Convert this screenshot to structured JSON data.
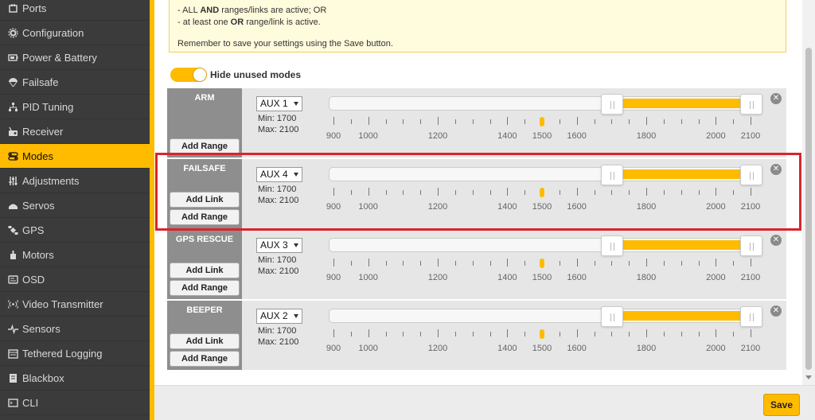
{
  "sidebar": {
    "items": [
      {
        "label": "Ports",
        "icon": "ports-icon"
      },
      {
        "label": "Configuration",
        "icon": "gear-icon"
      },
      {
        "label": "Power & Battery",
        "icon": "battery-icon"
      },
      {
        "label": "Failsafe",
        "icon": "parachute-icon"
      },
      {
        "label": "PID Tuning",
        "icon": "pid-tuning-icon"
      },
      {
        "label": "Receiver",
        "icon": "receiver-icon"
      },
      {
        "label": "Modes",
        "icon": "modes-icon",
        "active": true
      },
      {
        "label": "Adjustments",
        "icon": "sliders-icon"
      },
      {
        "label": "Servos",
        "icon": "servo-icon"
      },
      {
        "label": "GPS",
        "icon": "satellite-icon"
      },
      {
        "label": "Motors",
        "icon": "motor-icon"
      },
      {
        "label": "OSD",
        "icon": "osd-icon"
      },
      {
        "label": "Video Transmitter",
        "icon": "broadcast-icon"
      },
      {
        "label": "Sensors",
        "icon": "pulse-icon"
      },
      {
        "label": "Tethered Logging",
        "icon": "log-icon"
      },
      {
        "label": "Blackbox",
        "icon": "blackbox-icon"
      },
      {
        "label": "CLI",
        "icon": "terminal-icon"
      }
    ]
  },
  "note": {
    "line1": "- ALL ",
    "line1_bold": "AND",
    "line1_rest": " ranges/links are active; OR",
    "line2": "- at least one ",
    "line2_bold": "OR",
    "line2_rest": " range/link is active.",
    "line3": "Remember to save your settings using the Save button."
  },
  "toggle": {
    "label": "Hide unused modes",
    "on": true
  },
  "scale": {
    "min": 900,
    "max": 2100,
    "labels": [
      900,
      1000,
      1200,
      1400,
      1500,
      1600,
      1800,
      2000,
      2100
    ]
  },
  "modes": [
    {
      "name": "ARM",
      "aux": "AUX 1",
      "min_label": "Min: 1700",
      "max_label": "Max: 2100",
      "range_min": 1700,
      "range_max": 2100,
      "current": 1500,
      "buttons": [
        "Add Range"
      ]
    },
    {
      "name": "FAILSAFE",
      "aux": "AUX 4",
      "min_label": "Min: 1700",
      "max_label": "Max: 2100",
      "range_min": 1700,
      "range_max": 2100,
      "current": 1500,
      "buttons": [
        "Add Link",
        "Add Range"
      ]
    },
    {
      "name": "GPS RESCUE",
      "aux": "AUX 3",
      "min_label": "Min: 1700",
      "max_label": "Max: 2100",
      "range_min": 1700,
      "range_max": 2100,
      "current": 1500,
      "buttons": [
        "Add Link",
        "Add Range"
      ]
    },
    {
      "name": "BEEPER",
      "aux": "AUX 2",
      "min_label": "Min: 1700",
      "max_label": "Max: 2100",
      "range_min": 1700,
      "range_max": 2100,
      "current": 1500,
      "buttons": [
        "Add Link",
        "Add Range"
      ]
    }
  ],
  "footer": {
    "save_label": "Save"
  },
  "colors": {
    "accent": "#ffbb00",
    "sidebar": "#3b3b3b",
    "highlight": "#d9242e"
  }
}
